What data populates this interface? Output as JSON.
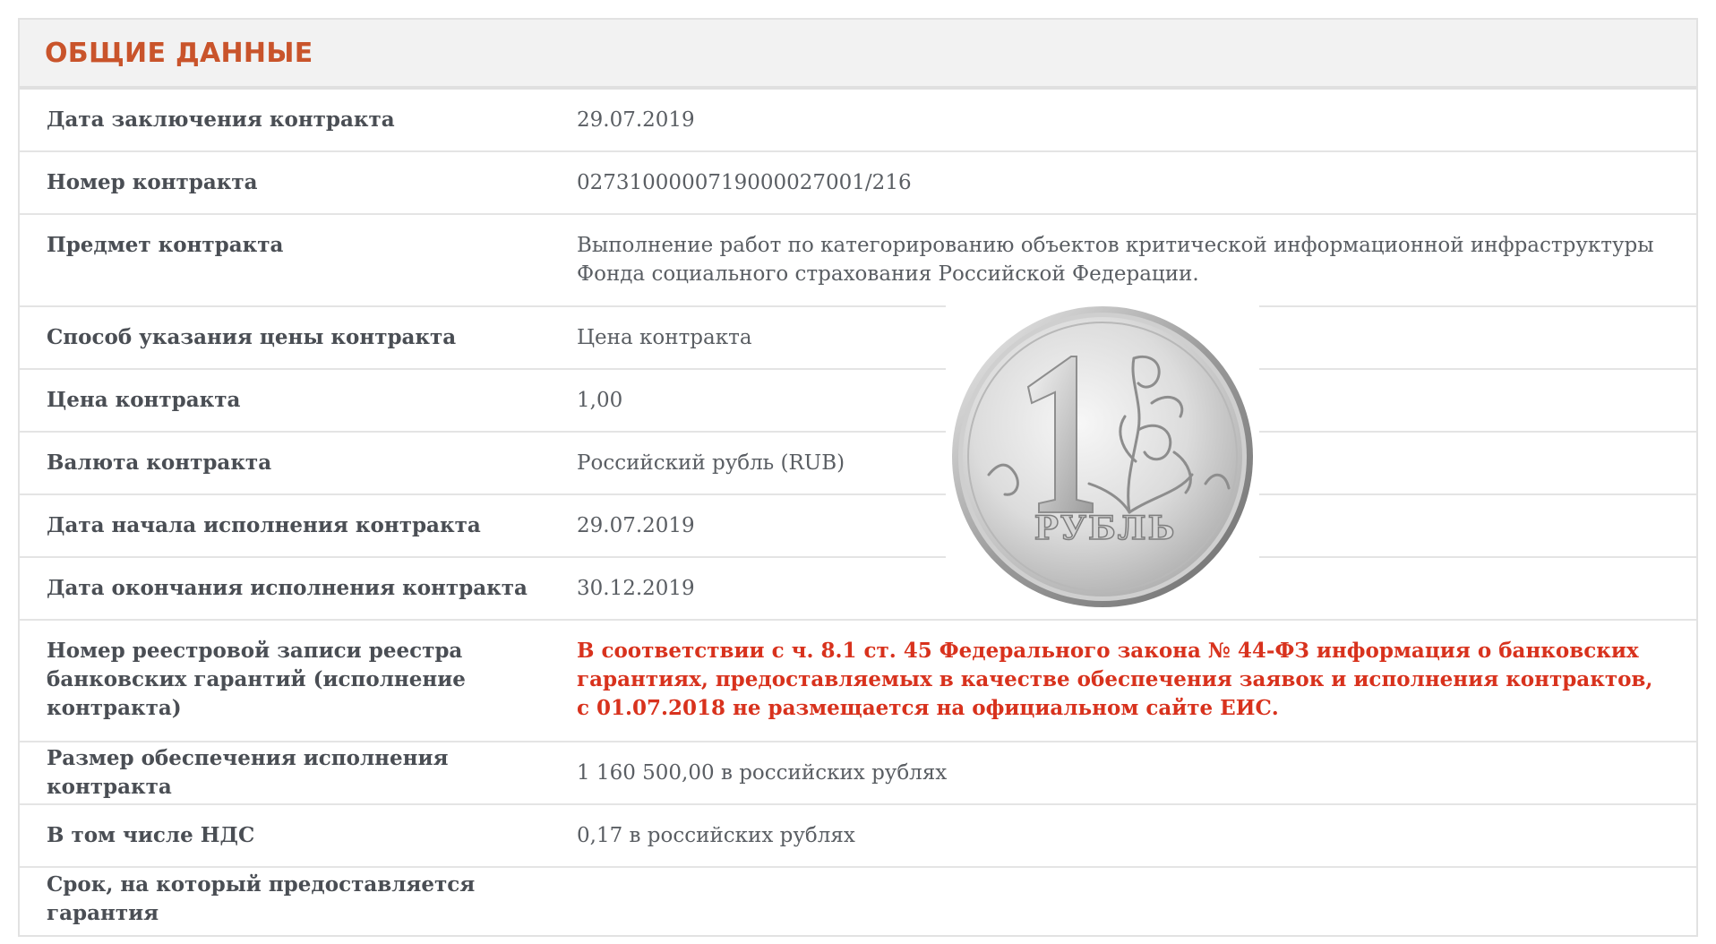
{
  "header": {
    "title": "ОБЩИЕ ДАННЫЕ"
  },
  "rows": [
    {
      "label": "Дата заключения контракта",
      "value": "29.07.2019"
    },
    {
      "label": "Номер контракта",
      "value": "0273100000719000027001/216"
    },
    {
      "label": "Предмет контракта",
      "value": "Выполнение работ по категорированию объектов критической информационной инфраструктуры Фонда социального страхования Российской Федерации."
    },
    {
      "label": "Способ указания цены контракта",
      "value": "Цена контракта"
    },
    {
      "label": "Цена контракта",
      "value": "1,00"
    },
    {
      "label": "Валюта контракта",
      "value": "Российский рубль (RUB)"
    },
    {
      "label": "Дата начала исполнения контракта",
      "value": "29.07.2019"
    },
    {
      "label": "Дата окончания исполнения контракта",
      "value": "30.12.2019"
    },
    {
      "label": "Номер реестровой записи реестра банковских гарантий (исполнение контракта)",
      "value": "В соответствии с ч. 8.1 ст. 45 Федерального закона № 44-ФЗ информация о банковских гарантиях, предоставляемых в качестве обеспечения заявок и исполнения контрактов, с 01.07.2018 не размещается на официальном сайте ЕИС."
    },
    {
      "label": "Размер обеспечения исполнения контракта",
      "value": "1 160 500,00 в российских рублях"
    },
    {
      "label": "В том числе НДС",
      "value": "0,17 в российских рублях"
    },
    {
      "label": "Срок, на который предоставляется гарантия",
      "value": ""
    }
  ],
  "coin": {
    "numeral": "1",
    "caption": "РУБЛЬ",
    "icon": "ruble-coin-icon"
  },
  "colors": {
    "title": "#c9542b",
    "warning": "#d8321d",
    "label": "#4a4e54",
    "value": "#5a5e63"
  }
}
